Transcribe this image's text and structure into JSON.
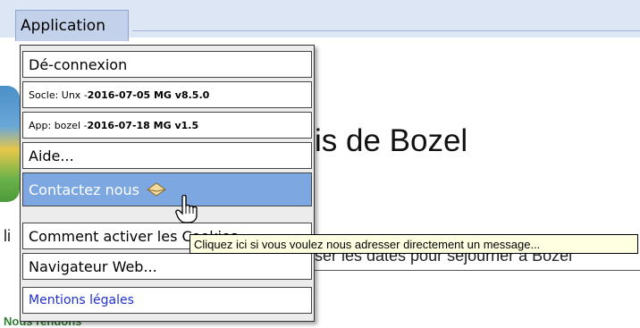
{
  "menubar": {
    "application_label": "Application"
  },
  "page": {
    "title_fragment": "is de Bozel",
    "left_fragment": "li",
    "right_fragment": "ser les dates pour séjourner à Bozel",
    "green_fragment": "Nous rendons"
  },
  "menu": {
    "items": [
      {
        "label": "Dé-connexion"
      },
      {
        "prefix": "Socle: Unx - ",
        "bold": "2016-07-05 MG v8.5.0"
      },
      {
        "prefix": "App: bozel - ",
        "bold": "2016-07-18 MG v1.5"
      },
      {
        "label": "Aide..."
      },
      {
        "label": "Contactez nous",
        "icon": "envelope-icon"
      },
      {
        "label": "Comment activer les Cookies"
      },
      {
        "label": "Navigateur Web..."
      },
      {
        "label": "Mentions légales"
      }
    ]
  },
  "tooltip": {
    "text": "Cliquez ici si vous voulez nous adresser directement un message..."
  },
  "colors": {
    "active_item": "#7da7e0",
    "tooltip_bg": "#ffffe1",
    "link": "#1f2fd0"
  }
}
